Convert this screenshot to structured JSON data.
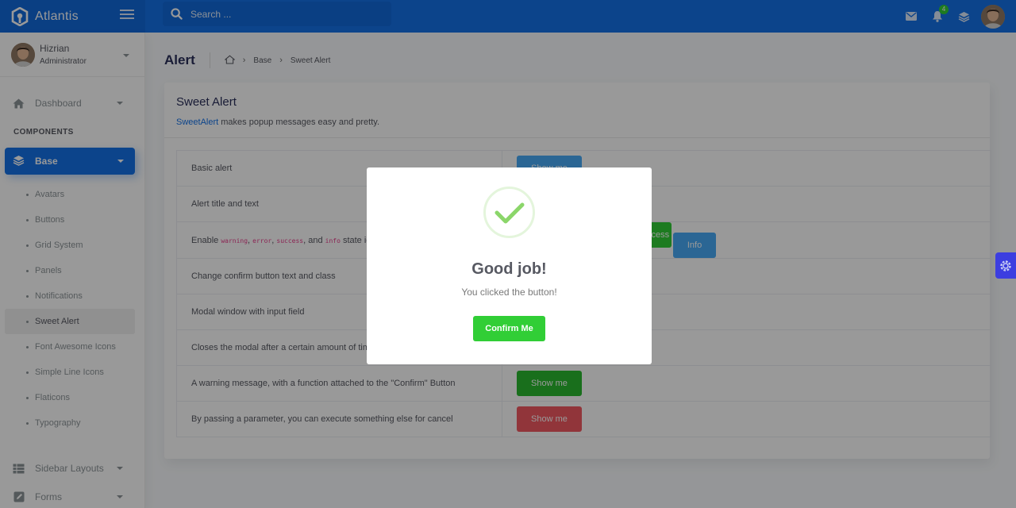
{
  "app": {
    "name": "Atlantis"
  },
  "search": {
    "placeholder": "Search ..."
  },
  "notifications": {
    "count": "4"
  },
  "user": {
    "name": "Hizrian",
    "role": "Administrator"
  },
  "sidebar": {
    "dashboard": "Dashboard",
    "section_components": "COMPONENTS",
    "base": "Base",
    "base_items": [
      "Avatars",
      "Buttons",
      "Grid System",
      "Panels",
      "Notifications",
      "Sweet Alert",
      "Font Awesome Icons",
      "Simple Line Icons",
      "Flaticons",
      "Typography"
    ],
    "sidebar_layouts": "Sidebar Layouts",
    "forms": "Forms"
  },
  "page": {
    "title": "Alert",
    "breadcrumbs": [
      "Base",
      "Sweet Alert"
    ]
  },
  "card": {
    "title": "Sweet Alert",
    "sub_link": "SweetAlert",
    "sub_text": " makes popup messages easy and pretty."
  },
  "rows": [
    {
      "label": "Basic alert",
      "buttons": [
        "Show me"
      ]
    },
    {
      "label": "Alert title and text",
      "buttons": []
    },
    {
      "label_pre": "Enable ",
      "codes": [
        "warning",
        "error",
        "success",
        "info"
      ],
      "label_post": " state ico",
      "buttons": [
        "ccess",
        "Info"
      ]
    },
    {
      "label": "Change confirm button text and class",
      "buttons": []
    },
    {
      "label": "Modal window with input field",
      "buttons": []
    },
    {
      "label": "Closes the modal after a certain amount of time (",
      "buttons": []
    },
    {
      "label": "A warning message, with a function attached to the \"Confirm\" Button",
      "buttons": [
        "Show me"
      ]
    },
    {
      "label": "By passing a parameter, you can execute something else for cancel",
      "buttons": [
        "Show me"
      ]
    }
  ],
  "modal": {
    "title": "Good job!",
    "text": "You clicked the button!",
    "confirm": "Confirm Me"
  },
  "colors": {
    "primary": "#1572e8",
    "success": "#31ce36",
    "info": "#48abf7",
    "danger": "#f25961"
  }
}
